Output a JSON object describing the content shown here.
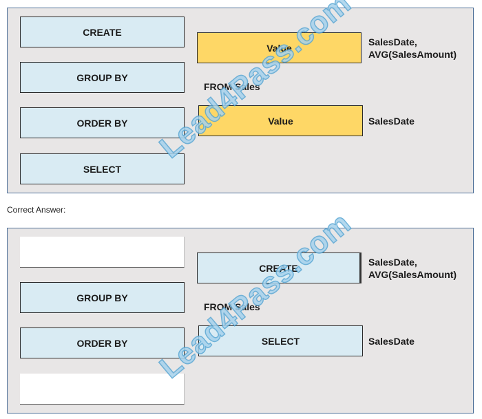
{
  "question": {
    "source_boxes": [
      "CREATE",
      "GROUP BY",
      "ORDER BY",
      "SELECT"
    ],
    "target_boxes": [
      "Value",
      "Value"
    ],
    "clause_1": [
      "SalesDate,",
      "AVG(SalesAmount)"
    ],
    "from_clause": "FROM Sales",
    "clause_2": "SalesDate"
  },
  "caption": "Correct Answer:",
  "answer": {
    "source_boxes": [
      "",
      "GROUP BY",
      "ORDER BY",
      ""
    ],
    "target_boxes": [
      "CREATE",
      "SELECT"
    ],
    "clause_1": [
      "SalesDate,",
      "AVG(SalesAmount)"
    ],
    "from_clause": "FROM Sales",
    "clause_2": "SalesDate"
  },
  "watermark": "Lead4Pass.com",
  "colors": {
    "source_fill": "#d9ebf3",
    "value_fill": "#fed766",
    "panel_border": "#4d6f98",
    "panel_bg": "#e8e6e6"
  }
}
